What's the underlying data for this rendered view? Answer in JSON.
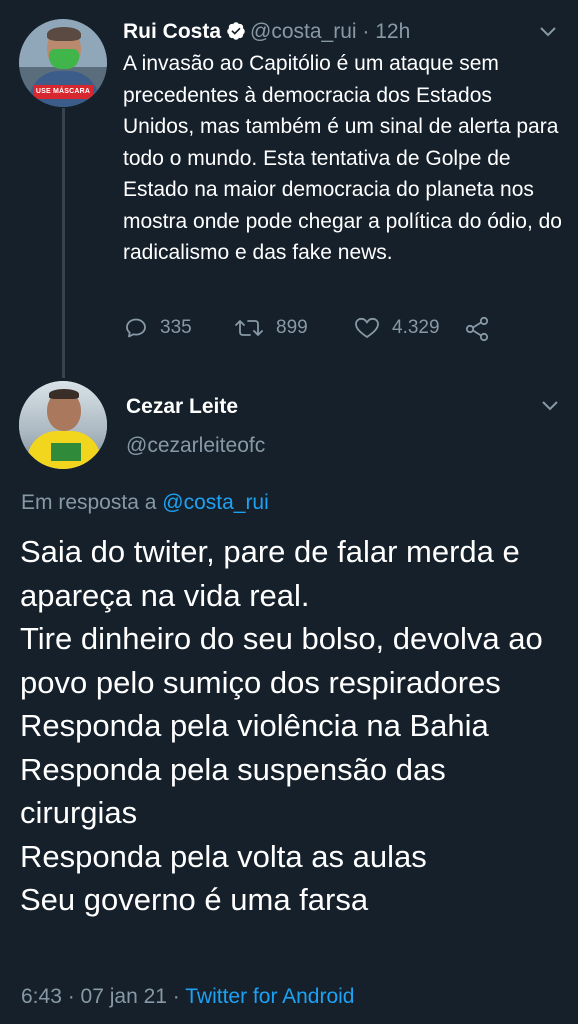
{
  "parent_tweet": {
    "name": "Rui Costa",
    "handle": "@costa_rui",
    "separator": "·",
    "time": "12h",
    "avatar_banner": "USE MÁSCARA",
    "text": "A invasão ao Capitólio é um ataque sem precedentes à democracia dos Estados Unidos, mas também é um sinal de alerta para todo o mundo. Esta tentativa de Golpe de Estado na maior democracia do planeta nos mostra onde pode chegar a política do ódio, do radicalismo e das fake news.",
    "replies": "335",
    "retweets": "899",
    "likes": "4.329"
  },
  "reply_tweet": {
    "name": "Cezar Leite",
    "handle": "@cezarleiteofc",
    "in_reply_prefix": "Em resposta a",
    "in_reply_mention": "@costa_rui",
    "lines": [
      "Saia do twiter, pare de falar merda e apareça na vida real.",
      "Tire dinheiro do seu bolso, devolva ao povo pelo sumiço dos respiradores",
      "Responda pela violência na Bahia",
      "Responda pela suspensão das cirurgias",
      "Responda pela volta as aulas",
      "Seu governo é uma farsa"
    ],
    "timestamp": "6:43 · 07 jan 21 ·",
    "source": "Twitter for Android"
  },
  "icons": {
    "verified": "verified-badge-icon",
    "chevron": "chevron-down-icon",
    "reply": "reply-icon",
    "retweet": "retweet-icon",
    "like": "heart-icon",
    "share": "share-icon"
  },
  "colors": {
    "background": "#15202b",
    "text": "#ffffff",
    "secondary": "#8899a6",
    "link": "#1da1f2",
    "thread_line": "#38444d"
  }
}
